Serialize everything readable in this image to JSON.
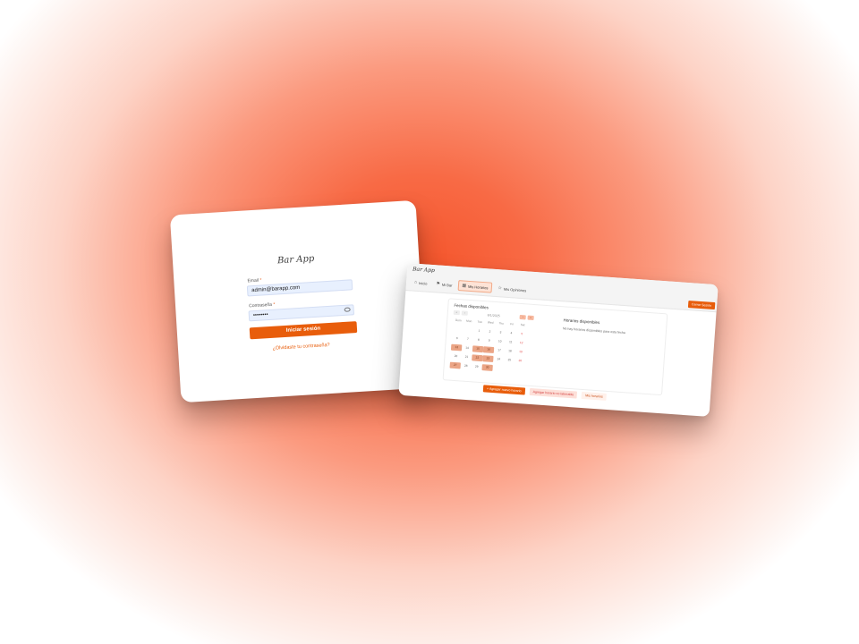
{
  "login": {
    "logo": "Bar App",
    "email_label": "Email",
    "email_value": "admin@barapp.com",
    "password_label": "Contraseña",
    "password_value": "••••••••",
    "required_mark": "*",
    "submit_label": "Iniciar sesión",
    "forgot_link": "¿Olvidaste tu contraseña?"
  },
  "dashboard": {
    "brand": "Bar App",
    "nav": [
      {
        "icon": "home-icon",
        "label": "Inicio",
        "active": false
      },
      {
        "icon": "flag-icon",
        "label": "Mi Bar",
        "active": false
      },
      {
        "icon": "calendar-icon",
        "label": "Mis Horarios",
        "active": true
      },
      {
        "icon": "star-icon",
        "label": "Mis Opiniones",
        "active": false
      }
    ],
    "logout_label": "Cerrar Sesión",
    "dates_title": "Fechas disponibles",
    "month_label": "6/1/2025",
    "weekdays": [
      "Dom",
      "Mon",
      "Tue",
      "Wed",
      "Thu",
      "Fri",
      "Sat"
    ],
    "calendar": [
      [
        "",
        "",
        "1",
        "2",
        "3",
        "4",
        "5"
      ],
      [
        "6",
        "7",
        "8",
        "9",
        "10",
        "11",
        "12"
      ],
      [
        "13",
        "14",
        "15",
        "16",
        "17",
        "18",
        "19"
      ],
      [
        "20",
        "21",
        "22",
        "23",
        "24",
        "25",
        "26"
      ],
      [
        "27",
        "28",
        "29",
        "30",
        "",
        "",
        ""
      ]
    ],
    "highlighted_days": [
      "13",
      "15",
      "16",
      "22",
      "23",
      "27",
      "30"
    ],
    "hours_title": "Horarios disponibles",
    "no_hours_text": "No hay horarios disponibles para esta fecha",
    "actions": {
      "add_label": "+ Agregar nuevo horario",
      "unavailable_label": "Agregar horario no laborable",
      "my_hours_label": "Mis horarios"
    },
    "colors": {
      "accent": "#e85d0b",
      "highlight": "#eba586"
    }
  }
}
